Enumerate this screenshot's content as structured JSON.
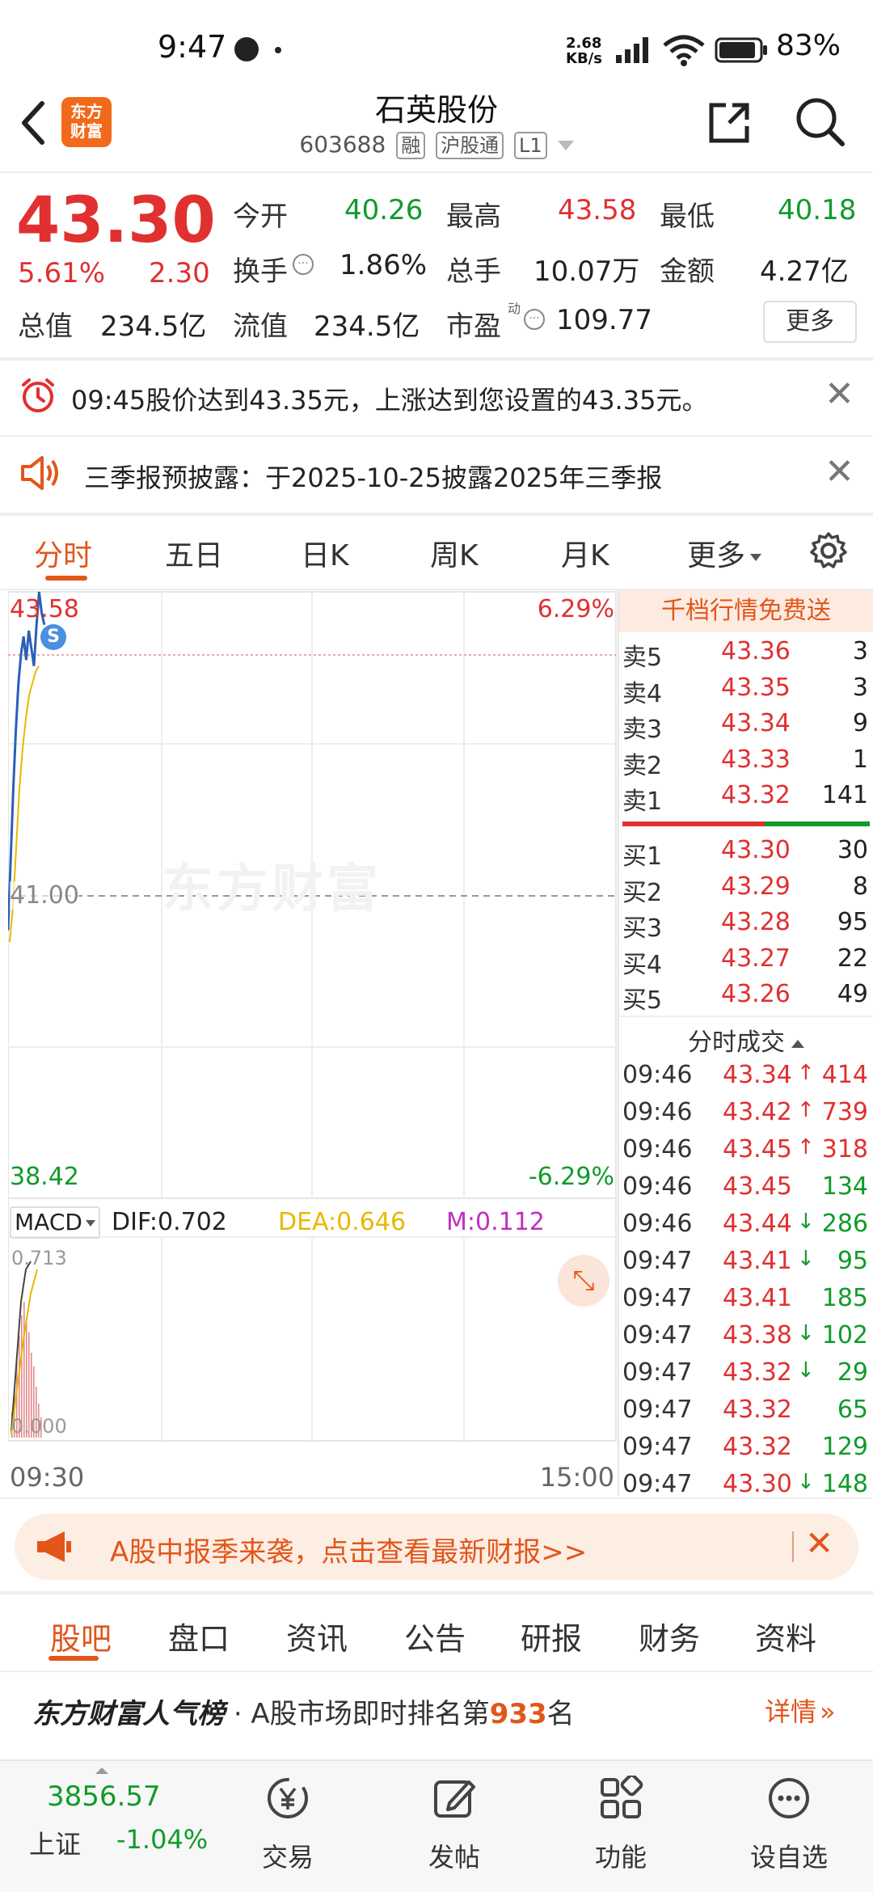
{
  "status_bar": {
    "time": "9:47",
    "net_speed_top": "2.68",
    "net_speed_bottom": "KB/s",
    "battery": "83%"
  },
  "header": {
    "title": "石英股份",
    "code": "603688",
    "tags": [
      "融",
      "沪股通",
      "L1"
    ],
    "logo_text_top": "东方",
    "logo_text_bottom": "财富"
  },
  "quote": {
    "price": "43.30",
    "change_pct": "5.61%",
    "change": "2.30",
    "open_label": "今开",
    "open": "40.26",
    "high_label": "最高",
    "high": "43.58",
    "low_label": "最低",
    "low": "40.18",
    "turnover_label": "换手",
    "turnover": "1.86%",
    "volume_label": "总手",
    "volume": "10.07万",
    "amount_label": "金额",
    "amount": "4.27亿",
    "mktcap_label": "总值",
    "mktcap": "234.5亿",
    "float_label": "流值",
    "float": "234.5亿",
    "pe_label": "市盈",
    "pe_sup": "动",
    "pe": "109.77",
    "more": "更多"
  },
  "notices": {
    "alert": "09:45股价达到43.35元，上涨达到您设置的43.35元。",
    "announce": "三季报预披露：于2025-10-25披露2025年三季报"
  },
  "chart_tabs": [
    "分时",
    "五日",
    "日K",
    "周K",
    "月K",
    "更多"
  ],
  "chart": {
    "max_price": "43.58",
    "max_pct": "6.29%",
    "min_price": "38.42",
    "min_pct": "-6.29%",
    "mid_price": "41.00",
    "watermark": "东方财富",
    "start_time": "09:30",
    "end_time": "15:00",
    "macd_label": "MACD",
    "dif": "DIF:0.702",
    "dea": "DEA:0.646",
    "m": "M:0.112",
    "macd_top": "0.713",
    "macd_bottom": "0.000",
    "marker": "S"
  },
  "chart_data": {
    "type": "line",
    "price_series": [
      40.7,
      41.3,
      41.9,
      42.4,
      42.8,
      43.05,
      43.2,
      43.0,
      43.25,
      43.1,
      42.95,
      43.3,
      43.58,
      43.4,
      43.3
    ],
    "avg_series": [
      40.6,
      40.9,
      41.4,
      41.9,
      42.25,
      42.5,
      42.7,
      42.8,
      42.9,
      42.95
    ],
    "ylim": [
      38.42,
      43.58
    ],
    "colors": {
      "price": "#2b5fb8",
      "avg": "#e8b800",
      "up": "#e03030",
      "down": "#109b2a"
    }
  },
  "orderbook": {
    "header": "千档行情免费送",
    "asks": [
      {
        "label": "卖5",
        "price": "43.36",
        "vol": "3"
      },
      {
        "label": "卖4",
        "price": "43.35",
        "vol": "3"
      },
      {
        "label": "卖3",
        "price": "43.34",
        "vol": "9"
      },
      {
        "label": "卖2",
        "price": "43.33",
        "vol": "1"
      },
      {
        "label": "卖1",
        "price": "43.32",
        "vol": "141"
      }
    ],
    "bids": [
      {
        "label": "买1",
        "price": "43.30",
        "vol": "30"
      },
      {
        "label": "买2",
        "price": "43.29",
        "vol": "8"
      },
      {
        "label": "买3",
        "price": "43.28",
        "vol": "95"
      },
      {
        "label": "买4",
        "price": "43.27",
        "vol": "22"
      },
      {
        "label": "买5",
        "price": "43.26",
        "vol": "49"
      }
    ],
    "trades_header": "分时成交",
    "trades": [
      {
        "time": "09:46",
        "price": "43.34",
        "dir": "↑",
        "vol": "414",
        "color": "red"
      },
      {
        "time": "09:46",
        "price": "43.42",
        "dir": "↑",
        "vol": "739",
        "color": "red"
      },
      {
        "time": "09:46",
        "price": "43.45",
        "dir": "↑",
        "vol": "318",
        "color": "red"
      },
      {
        "time": "09:46",
        "price": "43.45",
        "dir": "",
        "vol": "134",
        "color": "green"
      },
      {
        "time": "09:46",
        "price": "43.44",
        "dir": "↓",
        "vol": "286",
        "color": "green"
      },
      {
        "time": "09:47",
        "price": "43.41",
        "dir": "↓",
        "vol": "95",
        "color": "green"
      },
      {
        "time": "09:47",
        "price": "43.41",
        "dir": "",
        "vol": "185",
        "color": "green"
      },
      {
        "time": "09:47",
        "price": "43.38",
        "dir": "↓",
        "vol": "102",
        "color": "green"
      },
      {
        "time": "09:47",
        "price": "43.32",
        "dir": "↓",
        "vol": "29",
        "color": "green"
      },
      {
        "time": "09:47",
        "price": "43.32",
        "dir": "",
        "vol": "65",
        "color": "green"
      },
      {
        "time": "09:47",
        "price": "43.32",
        "dir": "",
        "vol": "129",
        "color": "green"
      },
      {
        "time": "09:47",
        "price": "43.30",
        "dir": "↓",
        "vol": "148",
        "color": "green"
      }
    ]
  },
  "banner": {
    "text": "A股中报季来袭，点击查看最新财报>>"
  },
  "bottom_tabs": [
    "股吧",
    "盘口",
    "资讯",
    "公告",
    "研报",
    "财务",
    "资料"
  ],
  "ranking": {
    "brand": "东方财富人气榜",
    "text_prefix": "· A股市场即时排名第",
    "rank": "933",
    "text_suffix": "名",
    "detail": "详情"
  },
  "bottom_nav": {
    "index_value": "3856.57",
    "index_name": "上证",
    "index_change": "-1.04%",
    "items": [
      "交易",
      "发帖",
      "功能",
      "设自选"
    ]
  }
}
